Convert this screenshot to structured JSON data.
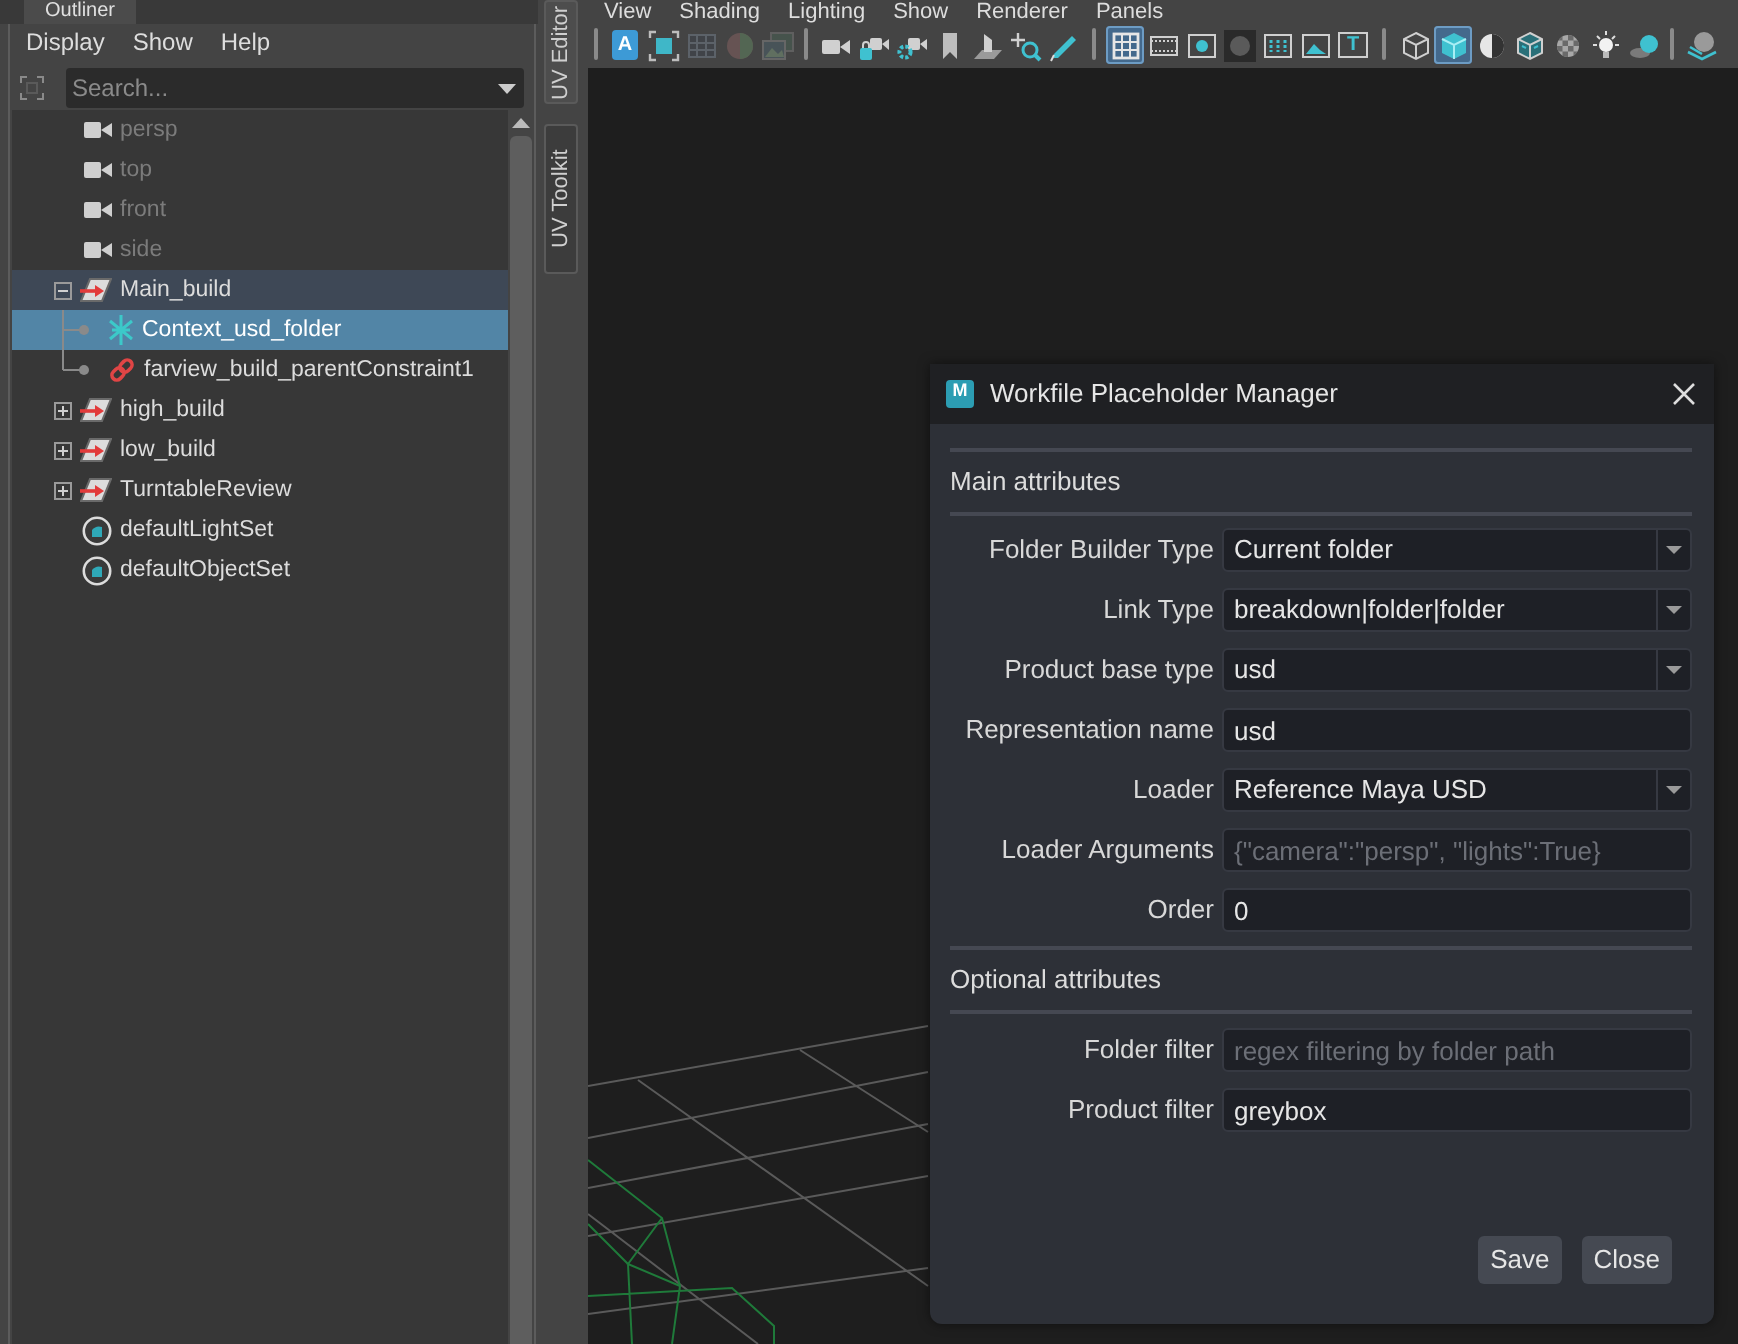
{
  "outliner": {
    "tab": "Outliner",
    "menu": [
      "Display",
      "Show",
      "Help"
    ],
    "search": {
      "placeholder": "Search..."
    },
    "items": [
      {
        "name": "persp",
        "kind": "camera",
        "hidden": true,
        "selected": false,
        "highlighted": false
      },
      {
        "name": "top",
        "kind": "camera",
        "hidden": true,
        "selected": false,
        "highlighted": false
      },
      {
        "name": "front",
        "kind": "camera",
        "hidden": true,
        "selected": false,
        "highlighted": false
      },
      {
        "name": "side",
        "kind": "camera",
        "hidden": true,
        "selected": false,
        "highlighted": false
      },
      {
        "name": "Main_build",
        "kind": "group",
        "hidden": false,
        "selected": false,
        "highlighted": true,
        "expanded": true,
        "children": [
          {
            "name": "Context_usd_folder",
            "kind": "locator",
            "hidden": false,
            "selected": true,
            "highlighted": false
          },
          {
            "name": "farview_build_parentConstraint1",
            "kind": "constraint",
            "hidden": false,
            "selected": false,
            "highlighted": false
          }
        ]
      },
      {
        "name": "high_build",
        "kind": "group",
        "hidden": false,
        "selected": false,
        "highlighted": false,
        "expanded": false
      },
      {
        "name": "low_build",
        "kind": "group",
        "hidden": false,
        "selected": false,
        "highlighted": false,
        "expanded": false
      },
      {
        "name": "TurntableReview",
        "kind": "group",
        "hidden": false,
        "selected": false,
        "highlighted": false,
        "expanded": false
      },
      {
        "name": "defaultLightSet",
        "kind": "set",
        "hidden": false,
        "selected": false,
        "highlighted": false
      },
      {
        "name": "defaultObjectSet",
        "kind": "set",
        "hidden": false,
        "selected": false,
        "highlighted": false
      }
    ]
  },
  "side_tabs": [
    {
      "label": "UV Editor",
      "selected": true
    },
    {
      "label": "UV Toolkit",
      "selected": false
    }
  ],
  "viewport": {
    "menu": [
      "View",
      "Shading",
      "Lighting",
      "Show",
      "Renderer",
      "Panels"
    ],
    "toolbar": [
      [
        {
          "active": false,
          "disabled": false,
          "label": "A"
        },
        {
          "active": false,
          "disabled": false
        },
        {
          "active": false,
          "disabled": true
        },
        {
          "active": false,
          "disabled": true
        },
        {
          "active": false,
          "disabled": true
        }
      ],
      [
        {
          "active": false,
          "disabled": false
        },
        {
          "active": false,
          "disabled": false
        },
        {
          "active": false,
          "disabled": false
        },
        {
          "active": false,
          "disabled": false
        },
        {
          "active": false,
          "disabled": false
        },
        {
          "active": false,
          "disabled": false
        },
        {
          "active": false,
          "disabled": false
        }
      ],
      [
        {
          "active": true,
          "disabled": false
        },
        {
          "active": false,
          "disabled": false
        },
        {
          "active": false,
          "disabled": false
        },
        {
          "active": false,
          "disabled": false
        },
        {
          "active": false,
          "disabled": false
        },
        {
          "active": false,
          "disabled": false
        },
        {
          "active": false,
          "disabled": false,
          "label": "T"
        }
      ],
      [
        {
          "active": false,
          "disabled": false
        },
        {
          "active": true,
          "disabled": false
        },
        {
          "active": false,
          "disabled": false
        },
        {
          "active": false,
          "disabled": false
        },
        {
          "active": false,
          "disabled": false
        },
        {
          "active": false,
          "disabled": false
        },
        {
          "active": false,
          "disabled": false
        }
      ],
      [
        {
          "active": false,
          "disabled": false
        }
      ]
    ]
  },
  "dialog": {
    "icon_label": "M",
    "title": "Workfile Placeholder Manager",
    "sections": [
      {
        "title": "Main attributes",
        "fields": [
          {
            "label": "Folder Builder Type",
            "kind": "dropdown",
            "value": "Current folder"
          },
          {
            "label": "Link Type",
            "kind": "dropdown",
            "value": "breakdown|folder|folder"
          },
          {
            "label": "Product base type",
            "kind": "dropdown",
            "value": "usd"
          },
          {
            "label": "Representation name",
            "kind": "text",
            "value": "usd"
          },
          {
            "label": "Loader",
            "kind": "dropdown",
            "value": "Reference Maya USD"
          },
          {
            "label": "Loader Arguments",
            "kind": "text",
            "placeholder": "{\"camera\":\"persp\", \"lights\":True}"
          },
          {
            "label": "Order",
            "kind": "text",
            "value": "0"
          }
        ]
      },
      {
        "title": "Optional attributes",
        "fields": [
          {
            "label": "Folder filter",
            "kind": "text",
            "placeholder": "regex filtering by folder path"
          },
          {
            "label": "Product filter",
            "kind": "text",
            "value": "greybox"
          }
        ]
      }
    ],
    "buttons": [
      "Save",
      "Close"
    ]
  }
}
